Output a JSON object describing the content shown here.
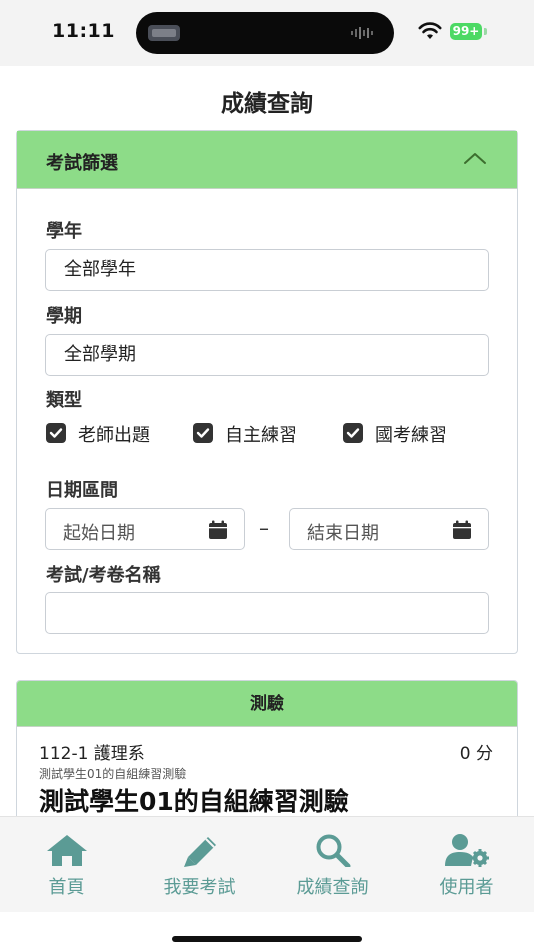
{
  "status_bar": {
    "time": "11:11",
    "battery": "99+"
  },
  "page": {
    "title": "成績查詢"
  },
  "filter": {
    "header": "考試篩選",
    "year_label": "學年",
    "year_value": "全部學年",
    "term_label": "學期",
    "term_value": "全部學期",
    "type_label": "類型",
    "types": [
      "老師出題",
      "自主練習",
      "國考練習"
    ],
    "date_label": "日期區間",
    "start_placeholder": "起始日期",
    "date_separator": "–",
    "end_placeholder": "結束日期",
    "name_label": "考試/考卷名稱",
    "name_value": ""
  },
  "results": {
    "header": "測驗",
    "items": [
      {
        "meta": "112-1 護理系",
        "score": "0 分",
        "subtitle": "測試學生01的自組練習測驗",
        "title": "測試學生01的自組練習測驗"
      }
    ]
  },
  "tabbar": {
    "items": [
      "首頁",
      "我要考試",
      "成績查詢",
      "使用者"
    ]
  },
  "colors": {
    "accent_green": "#8ddc88",
    "tab_teal": "#5b9b95",
    "battery_green": "#4cd964"
  }
}
